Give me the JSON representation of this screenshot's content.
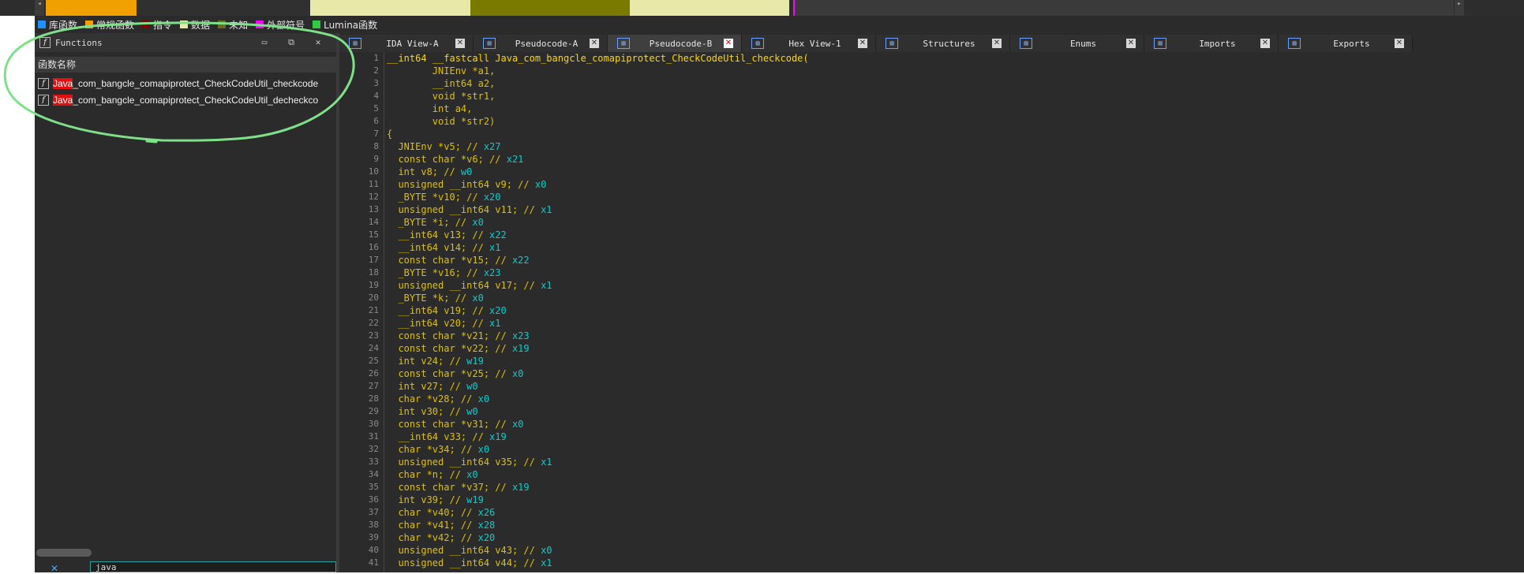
{
  "legend": [
    {
      "label": "库函数",
      "color": "#1e90ff"
    },
    {
      "label": "常规函数",
      "color": "#ff9900"
    },
    {
      "label": "指令",
      "color": "#800000"
    },
    {
      "label": "数据",
      "color": "#e8e8a8"
    },
    {
      "label": "未知",
      "color": "#6b6b1a"
    },
    {
      "label": "外部符号",
      "color": "#ff00ff"
    },
    {
      "label": "Lumina函数",
      "color": "#2ecc40"
    }
  ],
  "functions_panel": {
    "title": "Functions",
    "column_header": "函数名称",
    "rows": [
      {
        "highlight": "Java",
        "rest": "_com_bangcle_comapiprotect_CheckCodeUtil_checkcode"
      },
      {
        "highlight": "Java",
        "rest": "_com_bangcle_comapiprotect_CheckCodeUtil_decheckco"
      }
    ],
    "filter_value": "java",
    "close_glyph": "✕"
  },
  "tabs": [
    {
      "label": "IDA View-A",
      "active": false
    },
    {
      "label": "Pseudocode-A",
      "active": false
    },
    {
      "label": "Pseudocode-B",
      "active": true
    },
    {
      "label": "Hex View-1",
      "active": false
    },
    {
      "label": "Structures",
      "active": false
    },
    {
      "label": "Enums",
      "active": false
    },
    {
      "label": "Imports",
      "active": false
    },
    {
      "label": "Exports",
      "active": false
    }
  ],
  "code_lines": [
    "__int64 __fastcall Java_com_bangcle_comapiprotect_CheckCodeUtil_checkcode(",
    "        JNIEnv *a1,",
    "        __int64 a2,",
    "        void *str1,",
    "        int a4,",
    "        void *str2)",
    "{",
    "  JNIEnv *v5; // x27",
    "  const char *v6; // x21",
    "  int v8; // w0",
    "  unsigned __int64 v9; // x0",
    "  _BYTE *v10; // x20",
    "  unsigned __int64 v11; // x1",
    "  _BYTE *i; // x0",
    "  __int64 v13; // x22",
    "  __int64 v14; // x1",
    "  const char *v15; // x22",
    "  _BYTE *v16; // x23",
    "  unsigned __int64 v17; // x1",
    "  _BYTE *k; // x0",
    "  __int64 v19; // x20",
    "  __int64 v20; // x1",
    "  const char *v21; // x23",
    "  const char *v22; // x19",
    "  int v24; // w19",
    "  const char *v25; // x0",
    "  int v27; // w0",
    "  char *v28; // x0",
    "  int v30; // w0",
    "  const char *v31; // x0",
    "  __int64 v33; // x19",
    "  char *v34; // x0",
    "  unsigned __int64 v35; // x1",
    "  char *n; // x0",
    "  const char *v37; // x19",
    "  int v39; // w19",
    "  char *v40; // x26",
    "  char *v41; // x28",
    "  char *v42; // x20",
    "  unsigned __int64 v43; // x0",
    "  unsigned __int64 v44; // x1"
  ],
  "line_numbers": [
    "1",
    "2",
    "3",
    "4",
    "5",
    "6",
    "7",
    "8",
    "9",
    "10",
    "11",
    "12",
    "13",
    "14",
    "15",
    "16",
    "17",
    "18",
    "19",
    "20",
    "21",
    "22",
    "23",
    "24",
    "25",
    "26",
    "27",
    "28",
    "29",
    "30",
    "31",
    "32",
    "33",
    "34",
    "35",
    "36",
    "37",
    "38",
    "39",
    "40",
    "41"
  ]
}
